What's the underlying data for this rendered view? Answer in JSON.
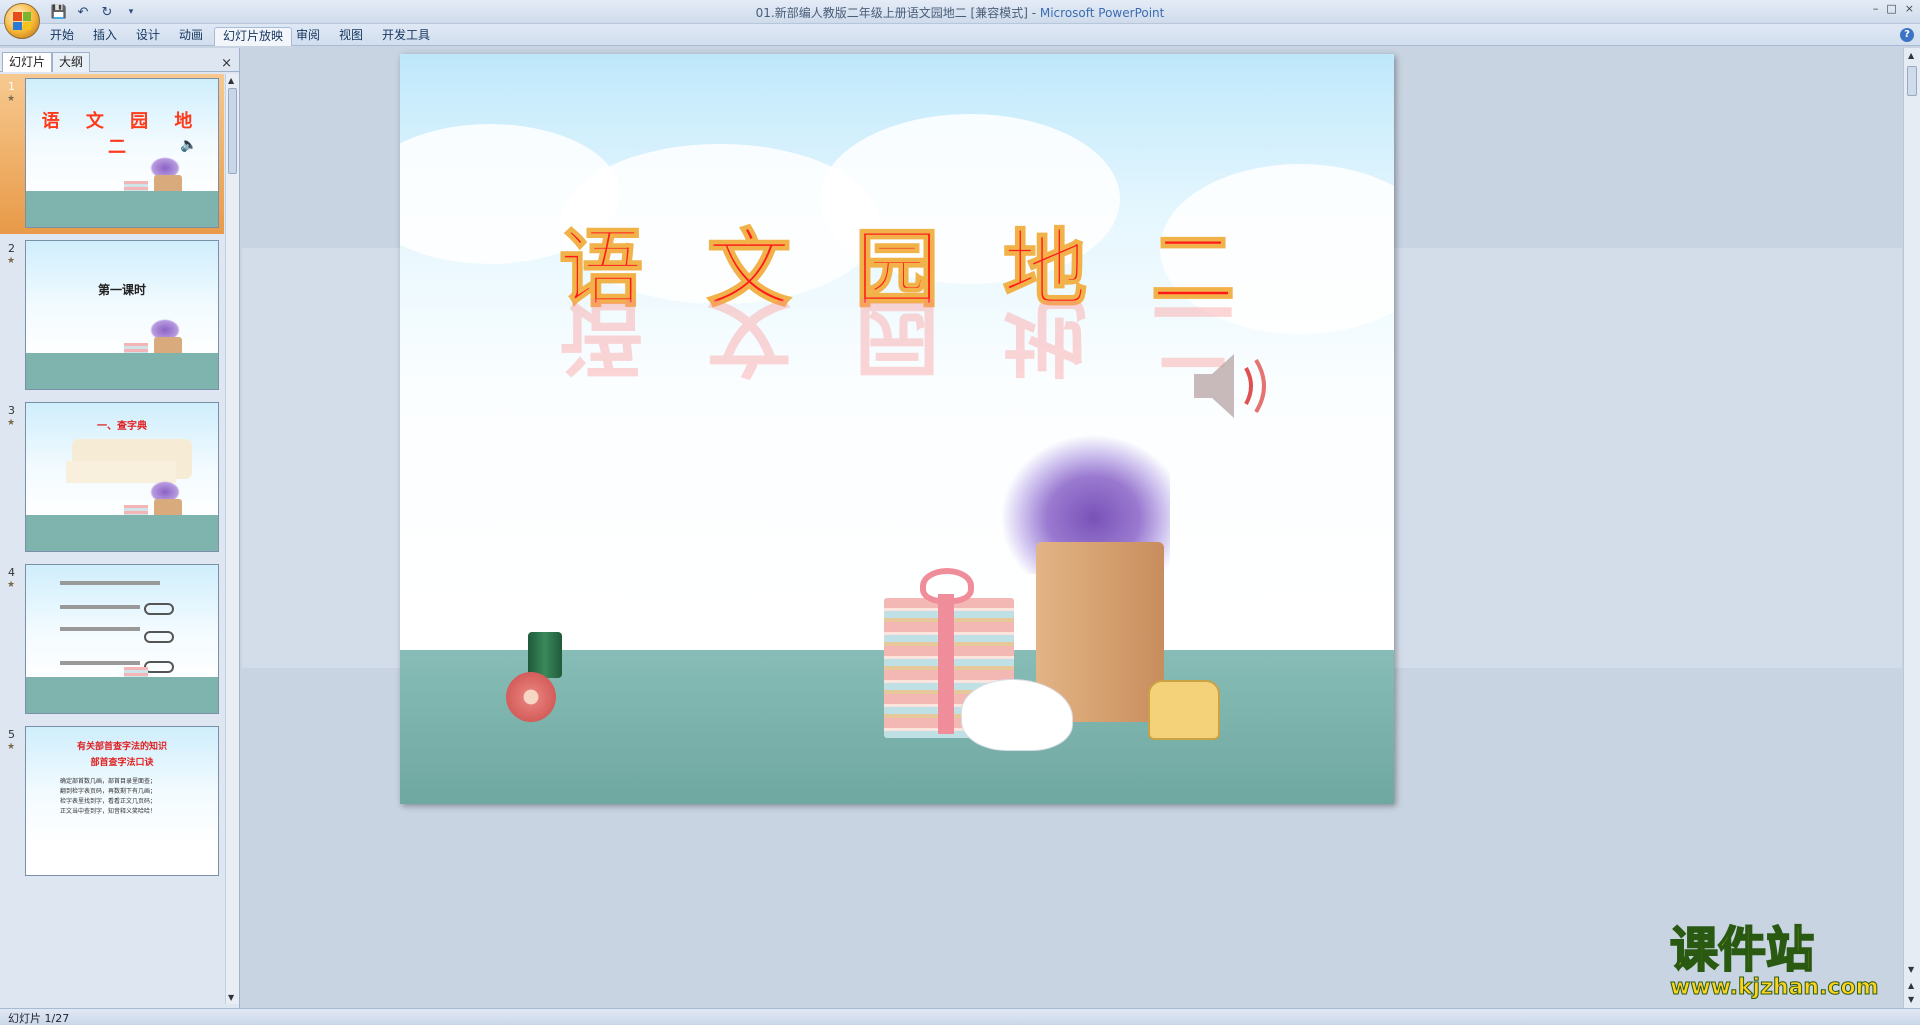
{
  "window": {
    "title": "01.新部编人教版二年级上册语文园地二 [兼容模式] - ",
    "app_name": "Microsoft PowerPoint",
    "controls": [
      "–",
      "□",
      "×"
    ]
  },
  "quick_access": {
    "icons": [
      "save-icon",
      "undo-icon",
      "redo-icon",
      "customize-icon"
    ]
  },
  "ribbon": {
    "tabs": [
      {
        "label": "开始"
      },
      {
        "label": "插入"
      },
      {
        "label": "设计"
      },
      {
        "label": "动画"
      },
      {
        "label": "幻灯片放映",
        "active": true
      },
      {
        "label": "审阅"
      },
      {
        "label": "视图"
      },
      {
        "label": "开发工具"
      }
    ],
    "help": "?"
  },
  "pane": {
    "tabs": [
      {
        "label": "幻灯片",
        "active": true
      },
      {
        "label": "大纲"
      }
    ],
    "close": "×",
    "thumbnails": [
      {
        "number": "1",
        "title": "语 文 园 地 二",
        "selected": true
      },
      {
        "number": "2",
        "title": "第一课时"
      },
      {
        "number": "3",
        "title": "一、查字典"
      },
      {
        "number": "4",
        "title": ""
      },
      {
        "number": "5",
        "title": "有关部首查字法的知识",
        "subtitle": "部首查字法口诀",
        "body": [
          "确定部首数几画，部首目录里面查；",
          "翻到检字表页码，再数剩下有几画；",
          "检字表里找到字，看看正文几页码；",
          "正文当中查到字，知音释义笑哈哈！"
        ]
      }
    ]
  },
  "slide": {
    "title": "语文园地二",
    "icons": [
      "speaker-icon"
    ]
  },
  "status": {
    "slide_counter": "幻灯片 1/27"
  },
  "watermark": {
    "name": "课件站",
    "url": "www.kjzhan.com"
  },
  "colors": {
    "title_red": "#ff1a1a",
    "title_outline": "#f2b24a",
    "selected_thumb": "#e89a48",
    "floor": "#7fb3ad"
  }
}
